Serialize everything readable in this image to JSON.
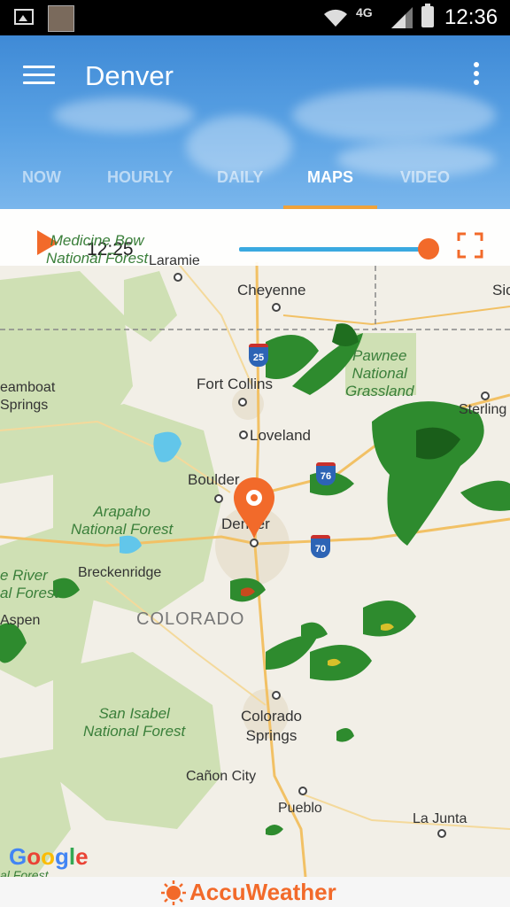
{
  "statusbar": {
    "network": "4G",
    "time": "12:36"
  },
  "header": {
    "title": "Denver",
    "tabs": [
      {
        "label": "NOW",
        "active": false
      },
      {
        "label": "HOURLY",
        "active": false
      },
      {
        "label": "DAILY",
        "active": false
      },
      {
        "label": "MAPS",
        "active": true
      },
      {
        "label": "VIDEO",
        "active": false
      }
    ]
  },
  "map": {
    "playback": {
      "time": "12:25",
      "progress": 1.0
    },
    "labels": {
      "laramie": "Laramie",
      "cheyenne": "Cheyenne",
      "fort_collins": "Fort Collins",
      "loveland": "Loveland",
      "boulder": "Boulder",
      "denver": "Denver",
      "breckenridge": "Breckenridge",
      "colorado": "COLORADO",
      "colorado_springs_1": "Colorado",
      "colorado_springs_2": "Springs",
      "canon_city": "Cañon City",
      "pueblo": "Pueblo",
      "la_junta": "La Junta",
      "sterling": "Sterling",
      "aspen": "Aspen",
      "steamboat_1": "eamboat",
      "steamboat_2": "Springs",
      "sio": "Sio",
      "medicine_bow_1": "Medicine Bow",
      "medicine_bow_2": "National Forest",
      "pawnee_1": "Pawnee",
      "pawnee_2": "National",
      "pawnee_3": "Grassland",
      "arapaho_1": "Arapaho",
      "arapaho_2": "National Forest",
      "white_river_1": "e River",
      "white_river_2": "al Forest",
      "san_isabel_1": "San Isabel",
      "san_isabel_2": "National Forest",
      "bottom_forest": "al Forest"
    },
    "shields": {
      "i25": "25",
      "i76": "76",
      "i70": "70"
    },
    "attribution": "Google"
  },
  "footer": {
    "brand": "AccuWeather"
  },
  "colors": {
    "accent": "#f26a2a",
    "slider": "#3aa9e0",
    "tab_indicator": "#f0a23a"
  }
}
